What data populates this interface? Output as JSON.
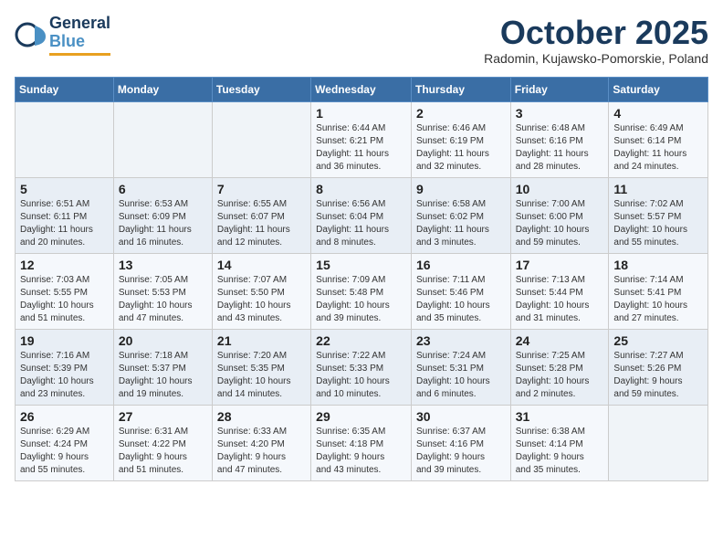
{
  "logo": {
    "line1": "General",
    "line2": "Blue"
  },
  "title": "October 2025",
  "subtitle": "Radomin, Kujawsko-Pomorskie, Poland",
  "headers": [
    "Sunday",
    "Monday",
    "Tuesday",
    "Wednesday",
    "Thursday",
    "Friday",
    "Saturday"
  ],
  "weeks": [
    [
      {
        "day": "",
        "info": ""
      },
      {
        "day": "",
        "info": ""
      },
      {
        "day": "",
        "info": ""
      },
      {
        "day": "1",
        "info": "Sunrise: 6:44 AM\nSunset: 6:21 PM\nDaylight: 11 hours\nand 36 minutes."
      },
      {
        "day": "2",
        "info": "Sunrise: 6:46 AM\nSunset: 6:19 PM\nDaylight: 11 hours\nand 32 minutes."
      },
      {
        "day": "3",
        "info": "Sunrise: 6:48 AM\nSunset: 6:16 PM\nDaylight: 11 hours\nand 28 minutes."
      },
      {
        "day": "4",
        "info": "Sunrise: 6:49 AM\nSunset: 6:14 PM\nDaylight: 11 hours\nand 24 minutes."
      }
    ],
    [
      {
        "day": "5",
        "info": "Sunrise: 6:51 AM\nSunset: 6:11 PM\nDaylight: 11 hours\nand 20 minutes."
      },
      {
        "day": "6",
        "info": "Sunrise: 6:53 AM\nSunset: 6:09 PM\nDaylight: 11 hours\nand 16 minutes."
      },
      {
        "day": "7",
        "info": "Sunrise: 6:55 AM\nSunset: 6:07 PM\nDaylight: 11 hours\nand 12 minutes."
      },
      {
        "day": "8",
        "info": "Sunrise: 6:56 AM\nSunset: 6:04 PM\nDaylight: 11 hours\nand 8 minutes."
      },
      {
        "day": "9",
        "info": "Sunrise: 6:58 AM\nSunset: 6:02 PM\nDaylight: 11 hours\nand 3 minutes."
      },
      {
        "day": "10",
        "info": "Sunrise: 7:00 AM\nSunset: 6:00 PM\nDaylight: 10 hours\nand 59 minutes."
      },
      {
        "day": "11",
        "info": "Sunrise: 7:02 AM\nSunset: 5:57 PM\nDaylight: 10 hours\nand 55 minutes."
      }
    ],
    [
      {
        "day": "12",
        "info": "Sunrise: 7:03 AM\nSunset: 5:55 PM\nDaylight: 10 hours\nand 51 minutes."
      },
      {
        "day": "13",
        "info": "Sunrise: 7:05 AM\nSunset: 5:53 PM\nDaylight: 10 hours\nand 47 minutes."
      },
      {
        "day": "14",
        "info": "Sunrise: 7:07 AM\nSunset: 5:50 PM\nDaylight: 10 hours\nand 43 minutes."
      },
      {
        "day": "15",
        "info": "Sunrise: 7:09 AM\nSunset: 5:48 PM\nDaylight: 10 hours\nand 39 minutes."
      },
      {
        "day": "16",
        "info": "Sunrise: 7:11 AM\nSunset: 5:46 PM\nDaylight: 10 hours\nand 35 minutes."
      },
      {
        "day": "17",
        "info": "Sunrise: 7:13 AM\nSunset: 5:44 PM\nDaylight: 10 hours\nand 31 minutes."
      },
      {
        "day": "18",
        "info": "Sunrise: 7:14 AM\nSunset: 5:41 PM\nDaylight: 10 hours\nand 27 minutes."
      }
    ],
    [
      {
        "day": "19",
        "info": "Sunrise: 7:16 AM\nSunset: 5:39 PM\nDaylight: 10 hours\nand 23 minutes."
      },
      {
        "day": "20",
        "info": "Sunrise: 7:18 AM\nSunset: 5:37 PM\nDaylight: 10 hours\nand 19 minutes."
      },
      {
        "day": "21",
        "info": "Sunrise: 7:20 AM\nSunset: 5:35 PM\nDaylight: 10 hours\nand 14 minutes."
      },
      {
        "day": "22",
        "info": "Sunrise: 7:22 AM\nSunset: 5:33 PM\nDaylight: 10 hours\nand 10 minutes."
      },
      {
        "day": "23",
        "info": "Sunrise: 7:24 AM\nSunset: 5:31 PM\nDaylight: 10 hours\nand 6 minutes."
      },
      {
        "day": "24",
        "info": "Sunrise: 7:25 AM\nSunset: 5:28 PM\nDaylight: 10 hours\nand 2 minutes."
      },
      {
        "day": "25",
        "info": "Sunrise: 7:27 AM\nSunset: 5:26 PM\nDaylight: 9 hours\nand 59 minutes."
      }
    ],
    [
      {
        "day": "26",
        "info": "Sunrise: 6:29 AM\nSunset: 4:24 PM\nDaylight: 9 hours\nand 55 minutes."
      },
      {
        "day": "27",
        "info": "Sunrise: 6:31 AM\nSunset: 4:22 PM\nDaylight: 9 hours\nand 51 minutes."
      },
      {
        "day": "28",
        "info": "Sunrise: 6:33 AM\nSunset: 4:20 PM\nDaylight: 9 hours\nand 47 minutes."
      },
      {
        "day": "29",
        "info": "Sunrise: 6:35 AM\nSunset: 4:18 PM\nDaylight: 9 hours\nand 43 minutes."
      },
      {
        "day": "30",
        "info": "Sunrise: 6:37 AM\nSunset: 4:16 PM\nDaylight: 9 hours\nand 39 minutes."
      },
      {
        "day": "31",
        "info": "Sunrise: 6:38 AM\nSunset: 4:14 PM\nDaylight: 9 hours\nand 35 minutes."
      },
      {
        "day": "",
        "info": ""
      }
    ]
  ]
}
